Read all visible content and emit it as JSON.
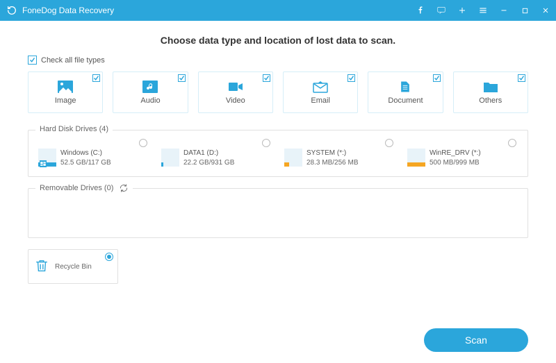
{
  "title": "FoneDog Data Recovery",
  "heading": "Choose data type and location of lost data to scan.",
  "check_all_label": "Check all file types",
  "types": [
    {
      "key": "image",
      "label": "Image"
    },
    {
      "key": "audio",
      "label": "Audio"
    },
    {
      "key": "video",
      "label": "Video"
    },
    {
      "key": "email",
      "label": "Email"
    },
    {
      "key": "document",
      "label": "Document"
    },
    {
      "key": "others",
      "label": "Others"
    }
  ],
  "hard_disk_legend": "Hard Disk Drives (4)",
  "drives": [
    {
      "name": "Windows (C:)",
      "space": "52.5 GB/117 GB",
      "color": "blue"
    },
    {
      "name": "DATA1 (D:)",
      "space": "22.2 GB/931 GB",
      "color": "blue"
    },
    {
      "name": "SYSTEM (*:)",
      "space": "28.3 MB/256 MB",
      "color": "orange"
    },
    {
      "name": "WinRE_DRV (*:)",
      "space": "500 MB/999 MB",
      "color": "orange"
    }
  ],
  "removable_legend": "Removable Drives (0)",
  "recycle_label": "Recycle Bin",
  "scan_label": "Scan"
}
